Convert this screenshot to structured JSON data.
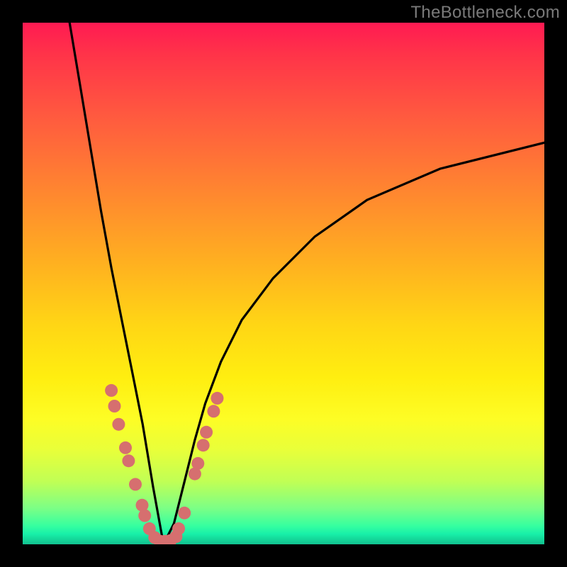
{
  "watermark": "TheBottleneck.com",
  "colors": {
    "frame": "#000000",
    "curve_stroke": "#000000",
    "dot_fill": "#d66f6f",
    "dot_stroke": "#a94d4d"
  },
  "chart_data": {
    "type": "line",
    "title": "",
    "xlabel": "",
    "ylabel": "",
    "xlim": [
      0,
      100
    ],
    "ylim": [
      0,
      100
    ],
    "grid": false,
    "legend": false,
    "series": [
      {
        "name": "bottleneck-curve",
        "note": "V-shaped curve; minimum at roughly x≈27 where y≈0. Left branch steep from (9,100)→(27,0); right branch asymptotically rises toward (100,~77).",
        "x": [
          9,
          11,
          13,
          15,
          17,
          19,
          21,
          23,
          25,
          27,
          29,
          31,
          33,
          35,
          38,
          42,
          48,
          56,
          66,
          80,
          100
        ],
        "y": [
          100,
          88,
          76,
          64,
          53,
          43,
          33,
          23,
          11,
          0,
          4,
          12,
          20,
          27,
          35,
          43,
          51,
          59,
          66,
          72,
          77
        ]
      }
    ],
    "scatter_points": {
      "note": "Approximate highlighted dots along the lower portion of the curve (bottleneck sweet-spot markers).",
      "points": [
        {
          "x": 17.0,
          "y": 29.5
        },
        {
          "x": 17.6,
          "y": 26.5
        },
        {
          "x": 18.4,
          "y": 23.0
        },
        {
          "x": 19.7,
          "y": 18.5
        },
        {
          "x": 20.3,
          "y": 16.0
        },
        {
          "x": 21.6,
          "y": 11.5
        },
        {
          "x": 22.9,
          "y": 7.5
        },
        {
          "x": 23.4,
          "y": 5.5
        },
        {
          "x": 24.3,
          "y": 3.0
        },
        {
          "x": 25.3,
          "y": 1.3
        },
        {
          "x": 26.3,
          "y": 0.6
        },
        {
          "x": 27.3,
          "y": 0.6
        },
        {
          "x": 28.3,
          "y": 0.7
        },
        {
          "x": 29.4,
          "y": 1.5
        },
        {
          "x": 29.9,
          "y": 3.0
        },
        {
          "x": 31.0,
          "y": 6.0
        },
        {
          "x": 33.0,
          "y": 13.5
        },
        {
          "x": 33.6,
          "y": 15.5
        },
        {
          "x": 34.6,
          "y": 19.0
        },
        {
          "x": 35.2,
          "y": 21.5
        },
        {
          "x": 36.6,
          "y": 25.5
        },
        {
          "x": 37.3,
          "y": 28.0
        }
      ]
    },
    "background_gradient": {
      "direction": "vertical",
      "stops": [
        {
          "pos": 0.0,
          "color": "#ff1a52"
        },
        {
          "pos": 0.18,
          "color": "#ff5a3f"
        },
        {
          "pos": 0.46,
          "color": "#ffb020"
        },
        {
          "pos": 0.68,
          "color": "#ffee10"
        },
        {
          "pos": 0.88,
          "color": "#c0ff55"
        },
        {
          "pos": 0.97,
          "color": "#18f0a8"
        },
        {
          "pos": 1.0,
          "color": "#12c090"
        }
      ]
    }
  }
}
